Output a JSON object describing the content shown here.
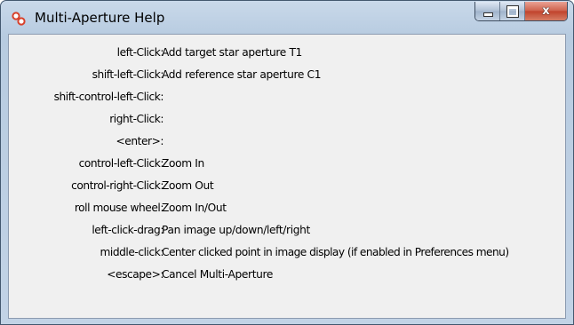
{
  "window": {
    "title": "Multi-Aperture Help",
    "close_glyph": "x",
    "icon": "multi-aperture-app-icon",
    "colors": {
      "frame": "#b7cbe0",
      "content_bg": "#f0f0f0",
      "close_button": "#c0422b"
    }
  },
  "help_rows": [
    {
      "key": "left-Click:",
      "desc": "Add target star aperture T1"
    },
    {
      "key": "shift-left-Click:",
      "desc": "Add reference star aperture C1"
    },
    {
      "key": "shift-control-left-Click:",
      "desc": ""
    },
    {
      "key": "right-Click:",
      "desc": ""
    },
    {
      "key": "<enter>:",
      "desc": ""
    },
    {
      "key": "control-left-Click:",
      "desc": "Zoom In"
    },
    {
      "key": "control-right-Click:",
      "desc": "Zoom Out"
    },
    {
      "key": "roll mouse wheel:",
      "desc": "Zoom In/Out"
    },
    {
      "key": "left-click-drag:",
      "desc": "Pan image up/down/left/right"
    },
    {
      "key": "middle-click:",
      "desc": "Center clicked point in image display (if enabled in Preferences menu)"
    },
    {
      "key": "<escape>:",
      "desc": "Cancel Multi-Aperture"
    }
  ]
}
